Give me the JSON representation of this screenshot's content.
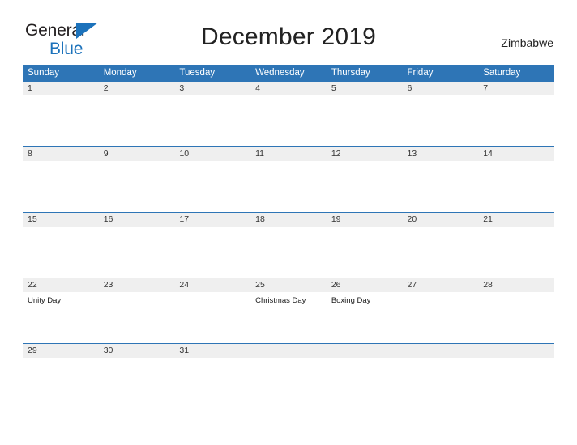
{
  "logo": {
    "line1": "General",
    "line2": "Blue",
    "mark": "triangle-mark",
    "color_dark": "#231f20",
    "color_blue": "#1c72bb"
  },
  "header": {
    "title": "December 2019",
    "country": "Zimbabwe"
  },
  "colors": {
    "header_blue": "#2e75b6",
    "stripe_gray": "#efefef",
    "text": "#333333"
  },
  "calendar": {
    "weekday_headers": [
      "Sunday",
      "Monday",
      "Tuesday",
      "Wednesday",
      "Thursday",
      "Friday",
      "Saturday"
    ],
    "weeks": [
      [
        {
          "day": "1",
          "event": ""
        },
        {
          "day": "2",
          "event": ""
        },
        {
          "day": "3",
          "event": ""
        },
        {
          "day": "4",
          "event": ""
        },
        {
          "day": "5",
          "event": ""
        },
        {
          "day": "6",
          "event": ""
        },
        {
          "day": "7",
          "event": ""
        }
      ],
      [
        {
          "day": "8",
          "event": ""
        },
        {
          "day": "9",
          "event": ""
        },
        {
          "day": "10",
          "event": ""
        },
        {
          "day": "11",
          "event": ""
        },
        {
          "day": "12",
          "event": ""
        },
        {
          "day": "13",
          "event": ""
        },
        {
          "day": "14",
          "event": ""
        }
      ],
      [
        {
          "day": "15",
          "event": ""
        },
        {
          "day": "16",
          "event": ""
        },
        {
          "day": "17",
          "event": ""
        },
        {
          "day": "18",
          "event": ""
        },
        {
          "day": "19",
          "event": ""
        },
        {
          "day": "20",
          "event": ""
        },
        {
          "day": "21",
          "event": ""
        }
      ],
      [
        {
          "day": "22",
          "event": "Unity Day"
        },
        {
          "day": "23",
          "event": ""
        },
        {
          "day": "24",
          "event": ""
        },
        {
          "day": "25",
          "event": "Christmas Day"
        },
        {
          "day": "26",
          "event": "Boxing Day"
        },
        {
          "day": "27",
          "event": ""
        },
        {
          "day": "28",
          "event": ""
        }
      ],
      [
        {
          "day": "29",
          "event": ""
        },
        {
          "day": "30",
          "event": ""
        },
        {
          "day": "31",
          "event": ""
        },
        {
          "day": "",
          "event": ""
        },
        {
          "day": "",
          "event": ""
        },
        {
          "day": "",
          "event": ""
        },
        {
          "day": "",
          "event": ""
        }
      ]
    ]
  }
}
